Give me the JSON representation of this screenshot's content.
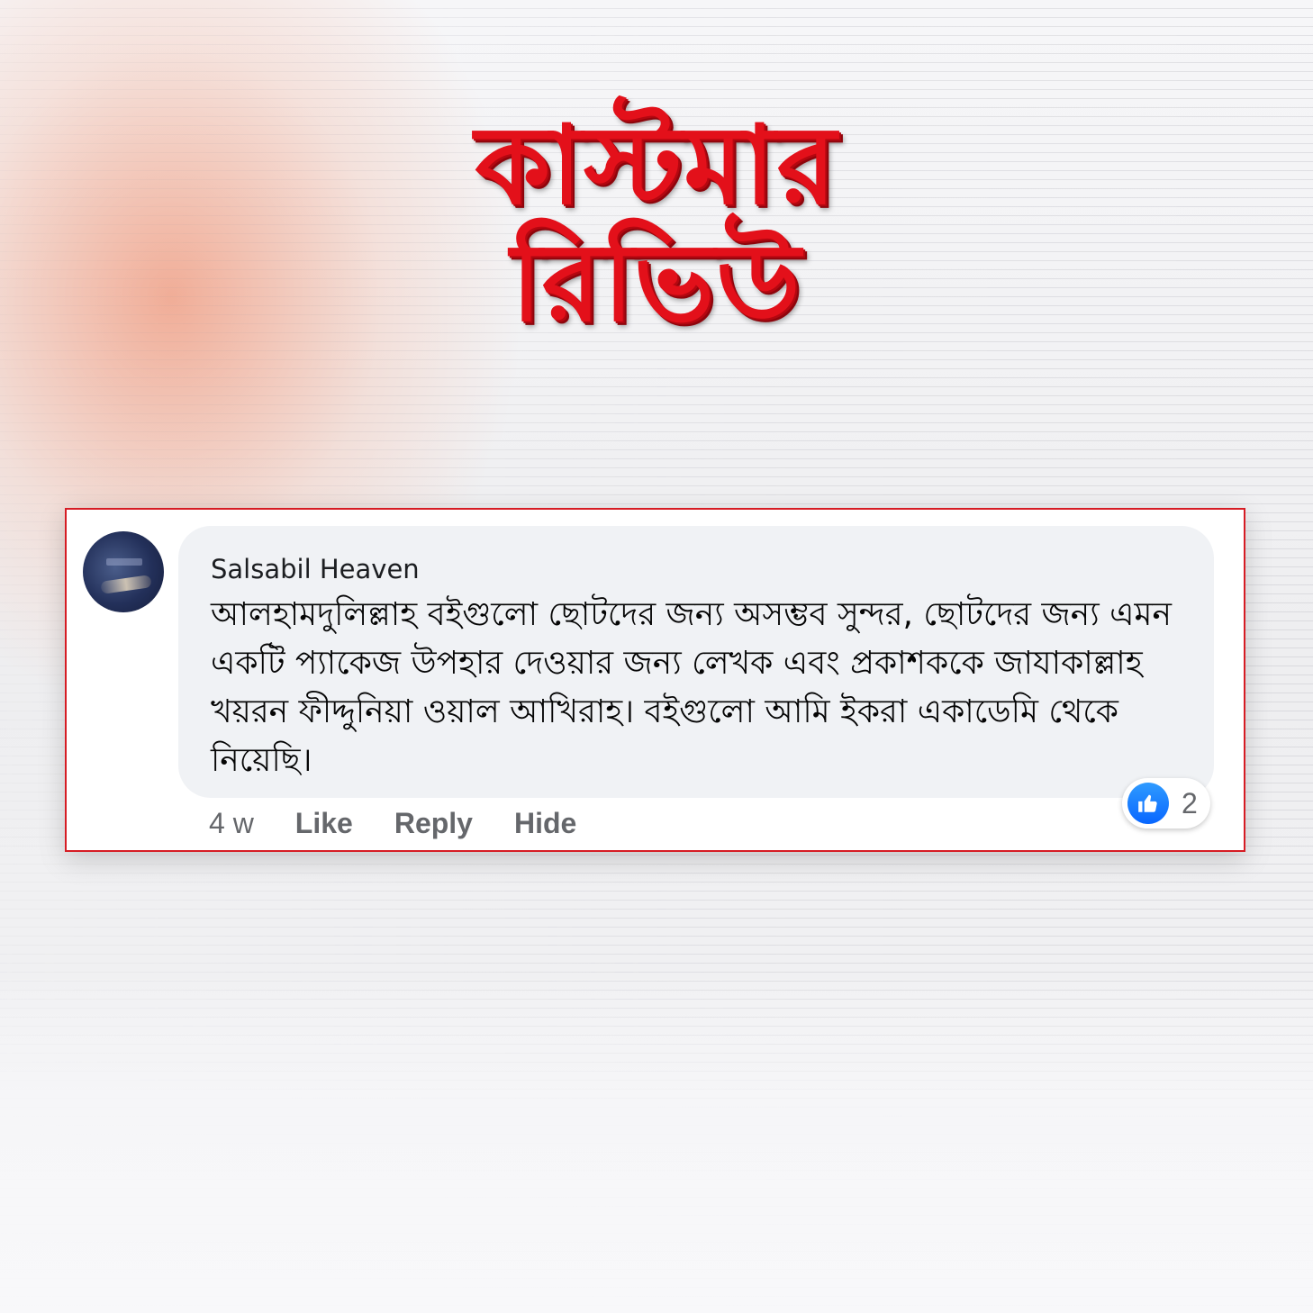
{
  "heading": {
    "line1": "কাস্টমার",
    "line2": "রিভিউ"
  },
  "comment": {
    "author": "Salsabil Heaven",
    "text": "আলহামদুলিল্লাহ বইগুলো ছোটদের জন্য অসম্ভব সুন্দর, ছোটদের জন্য এমন একটি প্যাকেজ উপহার দেওয়ার জন্য লেখক এবং প্রকাশককে জাযাকাল্লাহ খয়রন ফীদ্দুনিয়া ওয়াল আখিরাহ। বইগুলো আমি ইকরা একাডেমি থেকে নিয়েছি।",
    "time": "4 w",
    "actions": {
      "like": "Like",
      "reply": "Reply",
      "hide": "Hide"
    },
    "reactions": {
      "icon": "thumbs-up-icon",
      "count": "2"
    }
  },
  "colors": {
    "heading_red": "#e3101a",
    "card_border": "#d61c24",
    "like_blue": "#0866ff",
    "bubble_bg": "#f0f2f5",
    "meta_gray": "#65676b"
  }
}
